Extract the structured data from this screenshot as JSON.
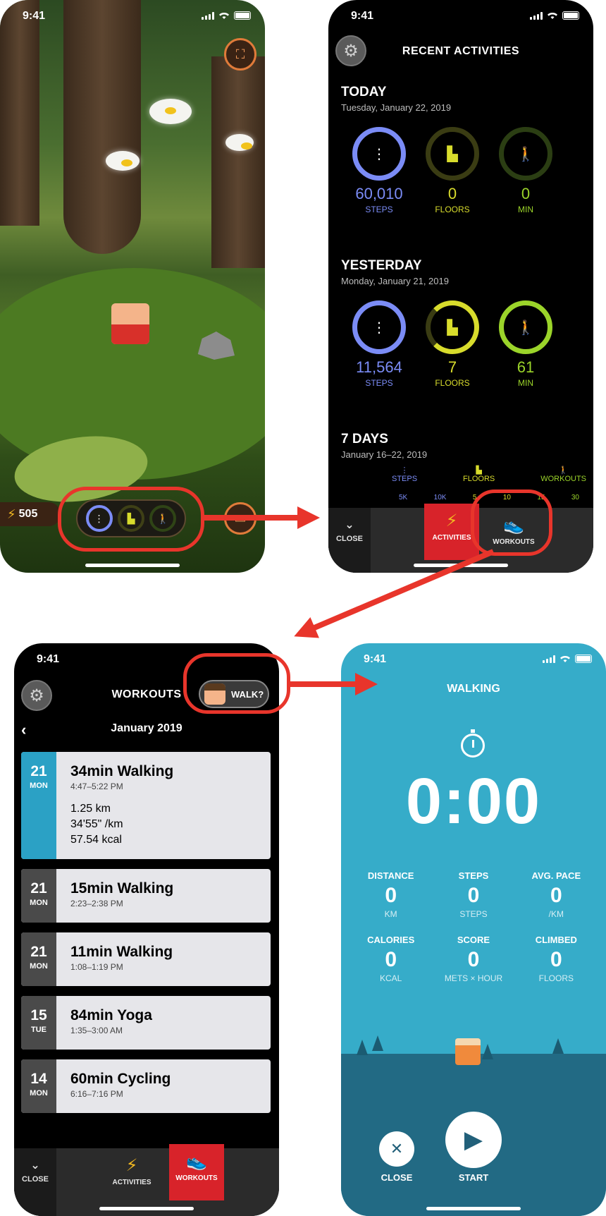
{
  "status": {
    "time": "9:41"
  },
  "screen1": {
    "coins": "505",
    "icons": [
      "bolt-icon",
      "steps-icon",
      "floors-icon",
      "walking-icon",
      "camera-icon",
      "menu-icon"
    ]
  },
  "screen2": {
    "title": "RECENT ACTIVITIES",
    "sections": [
      {
        "title": "TODAY",
        "date": "Tuesday, January 22, 2019",
        "stats": [
          {
            "value": "60,010",
            "label": "STEPS"
          },
          {
            "value": "0",
            "label": "FLOORS"
          },
          {
            "value": "0",
            "label": "MIN"
          }
        ]
      },
      {
        "title": "YESTERDAY",
        "date": "Monday, January 21, 2019",
        "stats": [
          {
            "value": "11,564",
            "label": "STEPS"
          },
          {
            "value": "7",
            "label": "FLOORS"
          },
          {
            "value": "61",
            "label": "MIN"
          }
        ]
      },
      {
        "title": "7 DAYS",
        "date": "January 16–22, 2019"
      }
    ],
    "legend": [
      "STEPS",
      "FLOORS",
      "WORKOUTS"
    ],
    "ticks": [
      "5K",
      "10K",
      "5",
      "10",
      "15",
      "30"
    ],
    "tabs": {
      "close": "CLOSE",
      "activities": "ACTIVITIES",
      "workouts": "WORKOUTS"
    }
  },
  "screen3": {
    "title": "WORKOUTS",
    "walk_button": "WALK?",
    "month": "January 2019",
    "workouts": [
      {
        "day": "21",
        "dow": "MON",
        "title": "34min Walking",
        "time": "4:47–5:22 PM",
        "details": [
          "1.25 km",
          "34'55\" /km",
          "57.54 kcal"
        ]
      },
      {
        "day": "21",
        "dow": "MON",
        "title": "15min Walking",
        "time": "2:23–2:38 PM"
      },
      {
        "day": "21",
        "dow": "MON",
        "title": "11min Walking",
        "time": "1:08–1:19 PM"
      },
      {
        "day": "15",
        "dow": "TUE",
        "title": "84min Yoga",
        "time": "1:35–3:00 AM"
      },
      {
        "day": "14",
        "dow": "MON",
        "title": "60min Cycling",
        "time": "6:16–7:16 PM"
      }
    ],
    "tabs": {
      "close": "CLOSE",
      "activities": "ACTIVITIES",
      "workouts": "WORKOUTS"
    }
  },
  "screen4": {
    "title": "WALKING",
    "timer": "0:00",
    "stats": [
      {
        "label": "DISTANCE",
        "value": "0",
        "unit": "KM"
      },
      {
        "label": "STEPS",
        "value": "0",
        "unit": "STEPS"
      },
      {
        "label": "AVG. PACE",
        "value": "0",
        "unit": "/KM"
      },
      {
        "label": "CALORIES",
        "value": "0",
        "unit": "KCAL"
      },
      {
        "label": "SCORE",
        "value": "0",
        "unit": "METS × HOUR"
      },
      {
        "label": "CLIMBED",
        "value": "0",
        "unit": "FLOORS"
      }
    ],
    "close_label": "CLOSE",
    "start_label": "START"
  },
  "colors": {
    "steps": "#7b8cf6",
    "floors": "#d8dc2c",
    "minutes": "#9bd42a",
    "highlight": "#e8352b",
    "walking_bg": "#36acc9"
  }
}
